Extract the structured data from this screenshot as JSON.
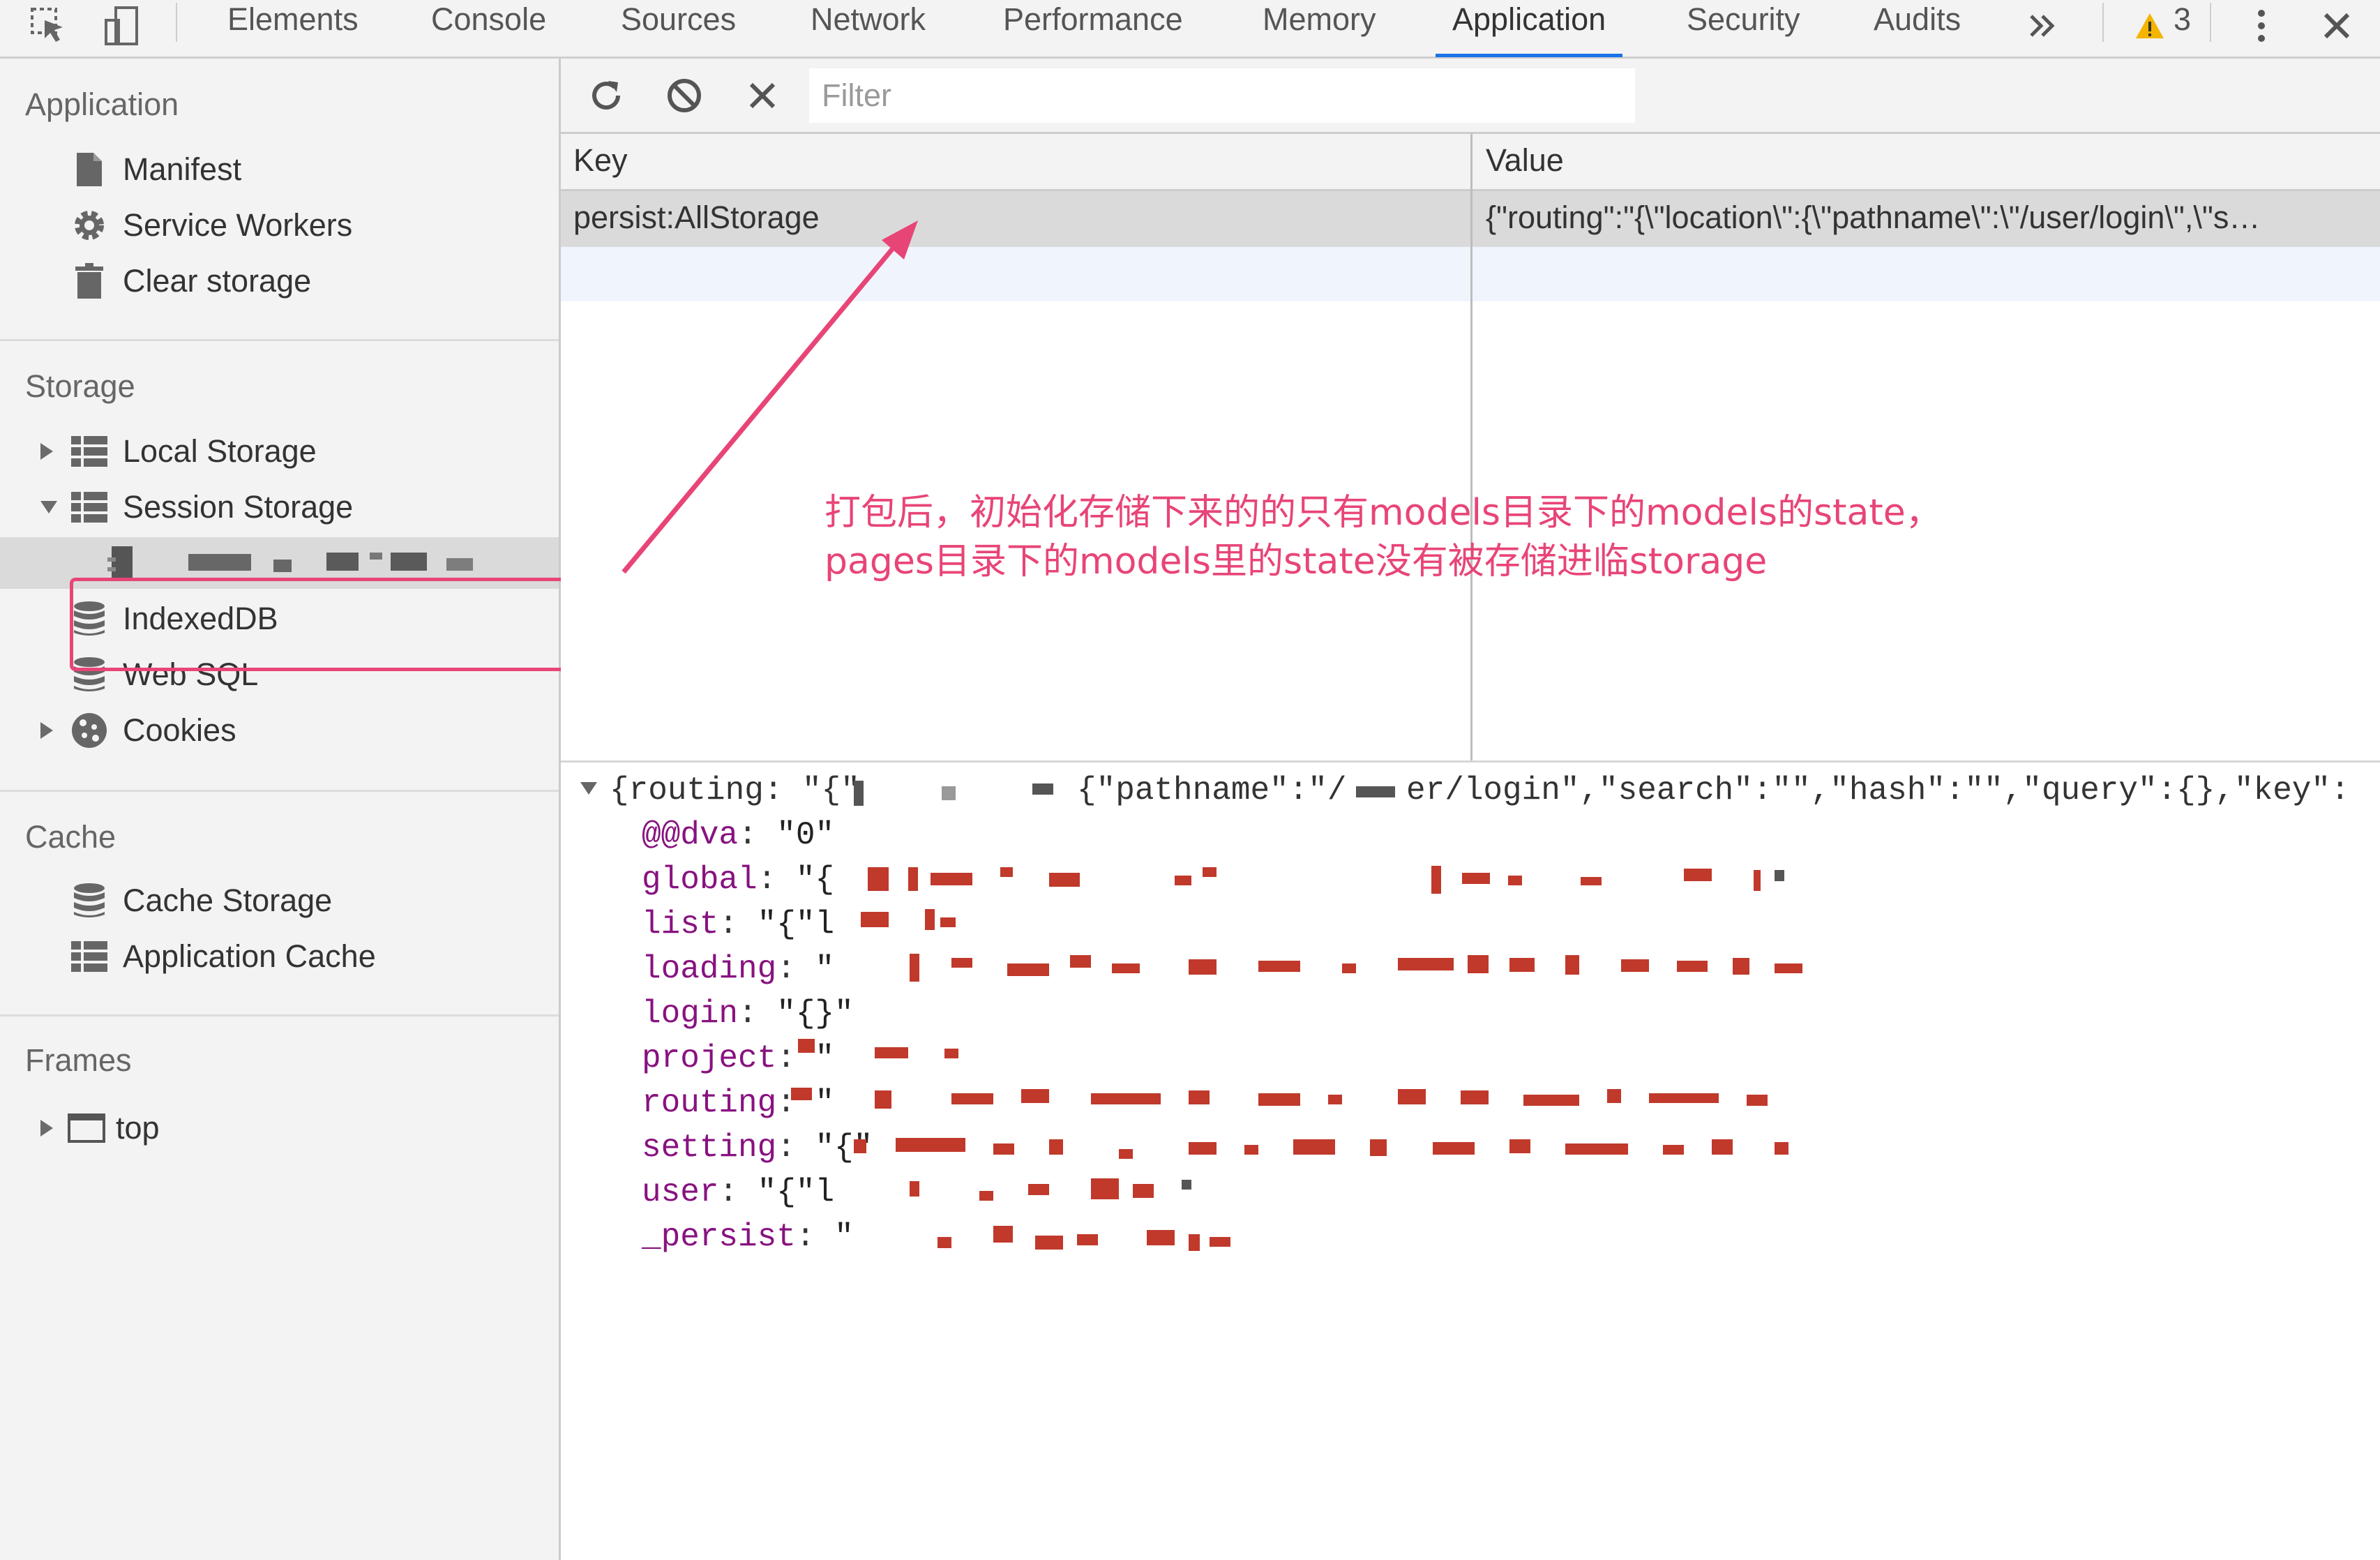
{
  "tabbar": {
    "tabs": [
      {
        "label": "Elements",
        "active": false
      },
      {
        "label": "Console",
        "active": false
      },
      {
        "label": "Sources",
        "active": false
      },
      {
        "label": "Network",
        "active": false
      },
      {
        "label": "Performance",
        "active": false
      },
      {
        "label": "Memory",
        "active": false
      },
      {
        "label": "Application",
        "active": true
      },
      {
        "label": "Security",
        "active": false
      },
      {
        "label": "Audits",
        "active": false
      }
    ],
    "overflow_icon": "double-chevron-right-icon",
    "warning_count": "3",
    "icons": [
      "inspect-element-icon",
      "device-toolbar-icon",
      "warning-icon",
      "more-vertical-icon",
      "close-icon"
    ]
  },
  "sidebar": {
    "application": {
      "title": "Application",
      "items": [
        {
          "label": "Manifest",
          "icon": "document-icon"
        },
        {
          "label": "Service Workers",
          "icon": "gear-icon"
        },
        {
          "label": "Clear storage",
          "icon": "trash-icon"
        }
      ]
    },
    "storage": {
      "title": "Storage",
      "items": [
        {
          "label": "Local Storage",
          "icon": "grid-icon",
          "expandable": true,
          "expanded": false
        },
        {
          "label": "Session Storage",
          "icon": "grid-icon",
          "expandable": true,
          "expanded": true
        },
        {
          "label": "",
          "icon": "document-icon",
          "selected": true,
          "redacted": true
        },
        {
          "label": "IndexedDB",
          "icon": "database-icon"
        },
        {
          "label": "Web SQL",
          "icon": "database-icon"
        },
        {
          "label": "Cookies",
          "icon": "cookie-icon",
          "expandable": true,
          "expanded": false
        }
      ]
    },
    "cache": {
      "title": "Cache",
      "items": [
        {
          "label": "Cache Storage",
          "icon": "database-icon"
        },
        {
          "label": "Application Cache",
          "icon": "grid-icon"
        }
      ]
    },
    "frames": {
      "title": "Frames",
      "items": [
        {
          "label": "top",
          "icon": "frame-icon",
          "expandable": true,
          "expanded": false
        }
      ]
    }
  },
  "toolbar": {
    "refresh_icon": "refresh-icon",
    "clear_all_icon": "block-icon",
    "delete_icon": "close-icon",
    "filter_placeholder": "Filter"
  },
  "table": {
    "columns": [
      "Key",
      "Value"
    ],
    "rows": [
      {
        "key": "persist:AllStorage",
        "value": "{\"routing\":\"{\\\"location\\\":{\\\"pathname\\\":\\\"/user/login\\\",\\\"s…",
        "selected": true
      }
    ]
  },
  "preview": {
    "root_prefix": "{routing: \"{\"",
    "root_visible": "{\"pathname\":\"/",
    "root_visible2": "er/login\",\"search\":\"\",\"hash\":\"\",\"query\":{},\"key\":",
    "entries": [
      {
        "key": "@@dva",
        "value": "\"0\""
      },
      {
        "key": "global",
        "value": "\"{"
      },
      {
        "key": "list",
        "value": "\"{\"l"
      },
      {
        "key": "loading",
        "value": "\""
      },
      {
        "key": "login",
        "value": "\"{}\""
      },
      {
        "key": "project",
        "value": "\""
      },
      {
        "key": "routing",
        "value": "\""
      },
      {
        "key": "setting",
        "value": "\"{\""
      },
      {
        "key": "user",
        "value": "\"{\"l"
      },
      {
        "key": "_persist",
        "value": "\""
      }
    ]
  },
  "annotation": {
    "line1": "打包后，初始化存储下来的的只有models目录下的models的state，",
    "line2": "pages目录下的models里的state没有被存储进临storage",
    "color": "#e84577"
  },
  "colors": {
    "accent": "#1a73e8",
    "annotation": "#e84577",
    "key_purple": "#881280",
    "warning": "#f4b400"
  }
}
